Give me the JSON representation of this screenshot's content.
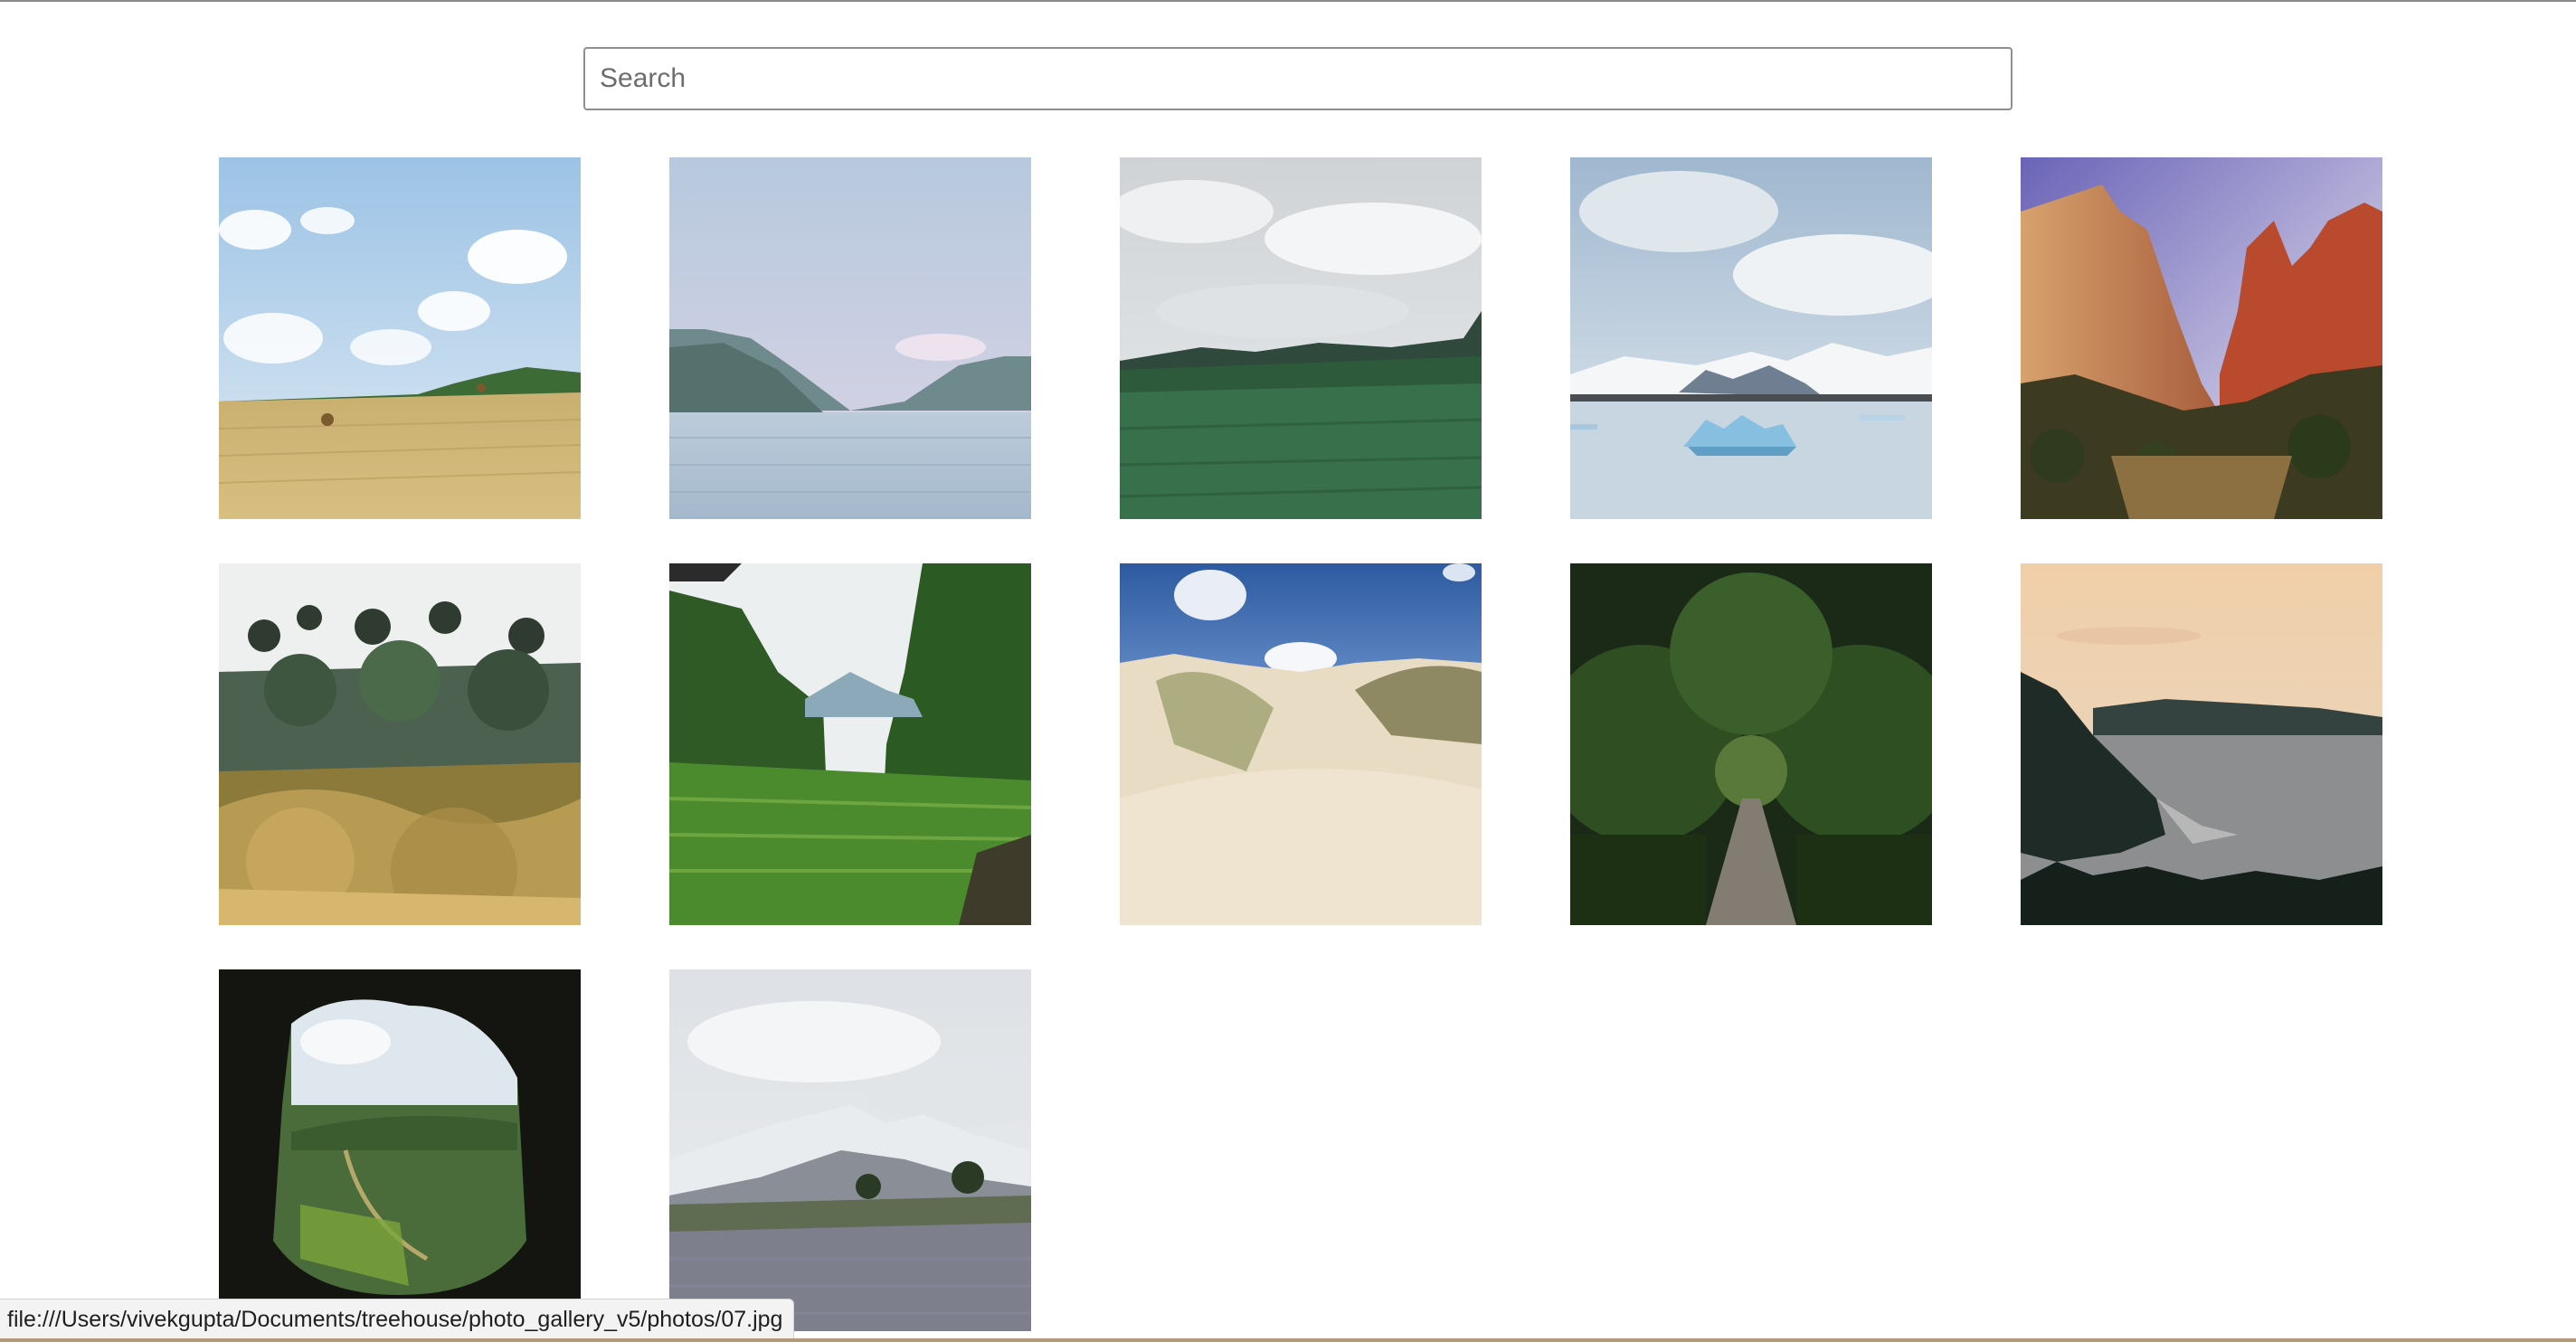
{
  "search": {
    "placeholder": "Search"
  },
  "gallery": {
    "photos": [
      {
        "name": "photo-01-wheat-field"
      },
      {
        "name": "photo-02-lake-mountains"
      },
      {
        "name": "photo-03-green-meadow"
      },
      {
        "name": "photo-04-glacier-lagoon"
      },
      {
        "name": "photo-05-red-canyon"
      },
      {
        "name": "photo-06-garden-trees"
      },
      {
        "name": "photo-07-green-valley"
      },
      {
        "name": "photo-08-sand-dunes"
      },
      {
        "name": "photo-09-forest-path"
      },
      {
        "name": "photo-10-coastal-cliffs"
      },
      {
        "name": "photo-11-cave-view"
      },
      {
        "name": "photo-12-snowy-mountain-field"
      }
    ]
  },
  "status_bar": {
    "url": "file:///Users/vivekgupta/Documents/treehouse/photo_gallery_v5/photos/07.jpg"
  }
}
